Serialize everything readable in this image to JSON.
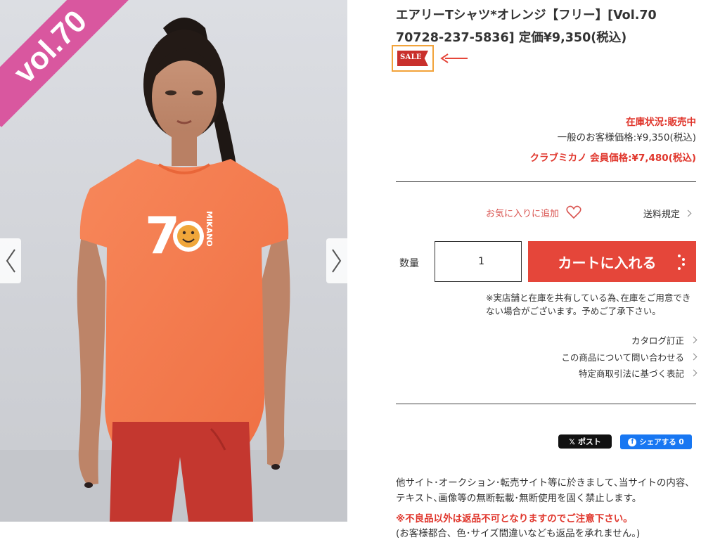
{
  "gallery": {
    "ribbon_text": "vol.70",
    "shirt_logo_number": "70",
    "shirt_logo_text": "MIKANO",
    "colors": {
      "ribbon": "#d9579f",
      "shirt": "#f47b4d",
      "leggings": "#c4372f",
      "background": "#d3d5da"
    }
  },
  "product": {
    "title": "エアリーTシャツ*オレンジ【フリー】[Vol.70 70728-237-5836] 定価¥9,350(税込)",
    "sale_badge": "SALE",
    "stock_status": "在庫状況:販売中",
    "general_price": "一般のお客様価格:¥9,350(税込)",
    "member_price": "クラブミカノ 会員価格:¥7,480(税込)"
  },
  "actions": {
    "favorite_label": "お気に入りに追加",
    "shipping_label": "送料規定",
    "quantity_label": "数量",
    "quantity_value": "1",
    "cart_button": "カートに入れる"
  },
  "notice": "※実店舗と在庫を共有している為､在庫をご用意できない場合がございます。予めご了承下さい。",
  "links": [
    "カタログ訂正",
    "この商品について問い合わせる",
    "特定商取引法に基づく表記"
  ],
  "share": {
    "x_post": "ポスト",
    "fb_share": "シェアする 0"
  },
  "legal": {
    "text": "他サイト･オークション･転売サイト等に於きまして､当サイトの内容､テキスト､画像等の無断転載･無断使用を固く禁止します。",
    "warning": "※不良品以外は返品不可となりますのでご注意下さい。",
    "warning_sub": "(お客様都合、色･サイズ間違いなども返品を承れません。)"
  },
  "colors": {
    "accent_red": "#e5463a",
    "sale_highlight": "#f2a33a"
  }
}
